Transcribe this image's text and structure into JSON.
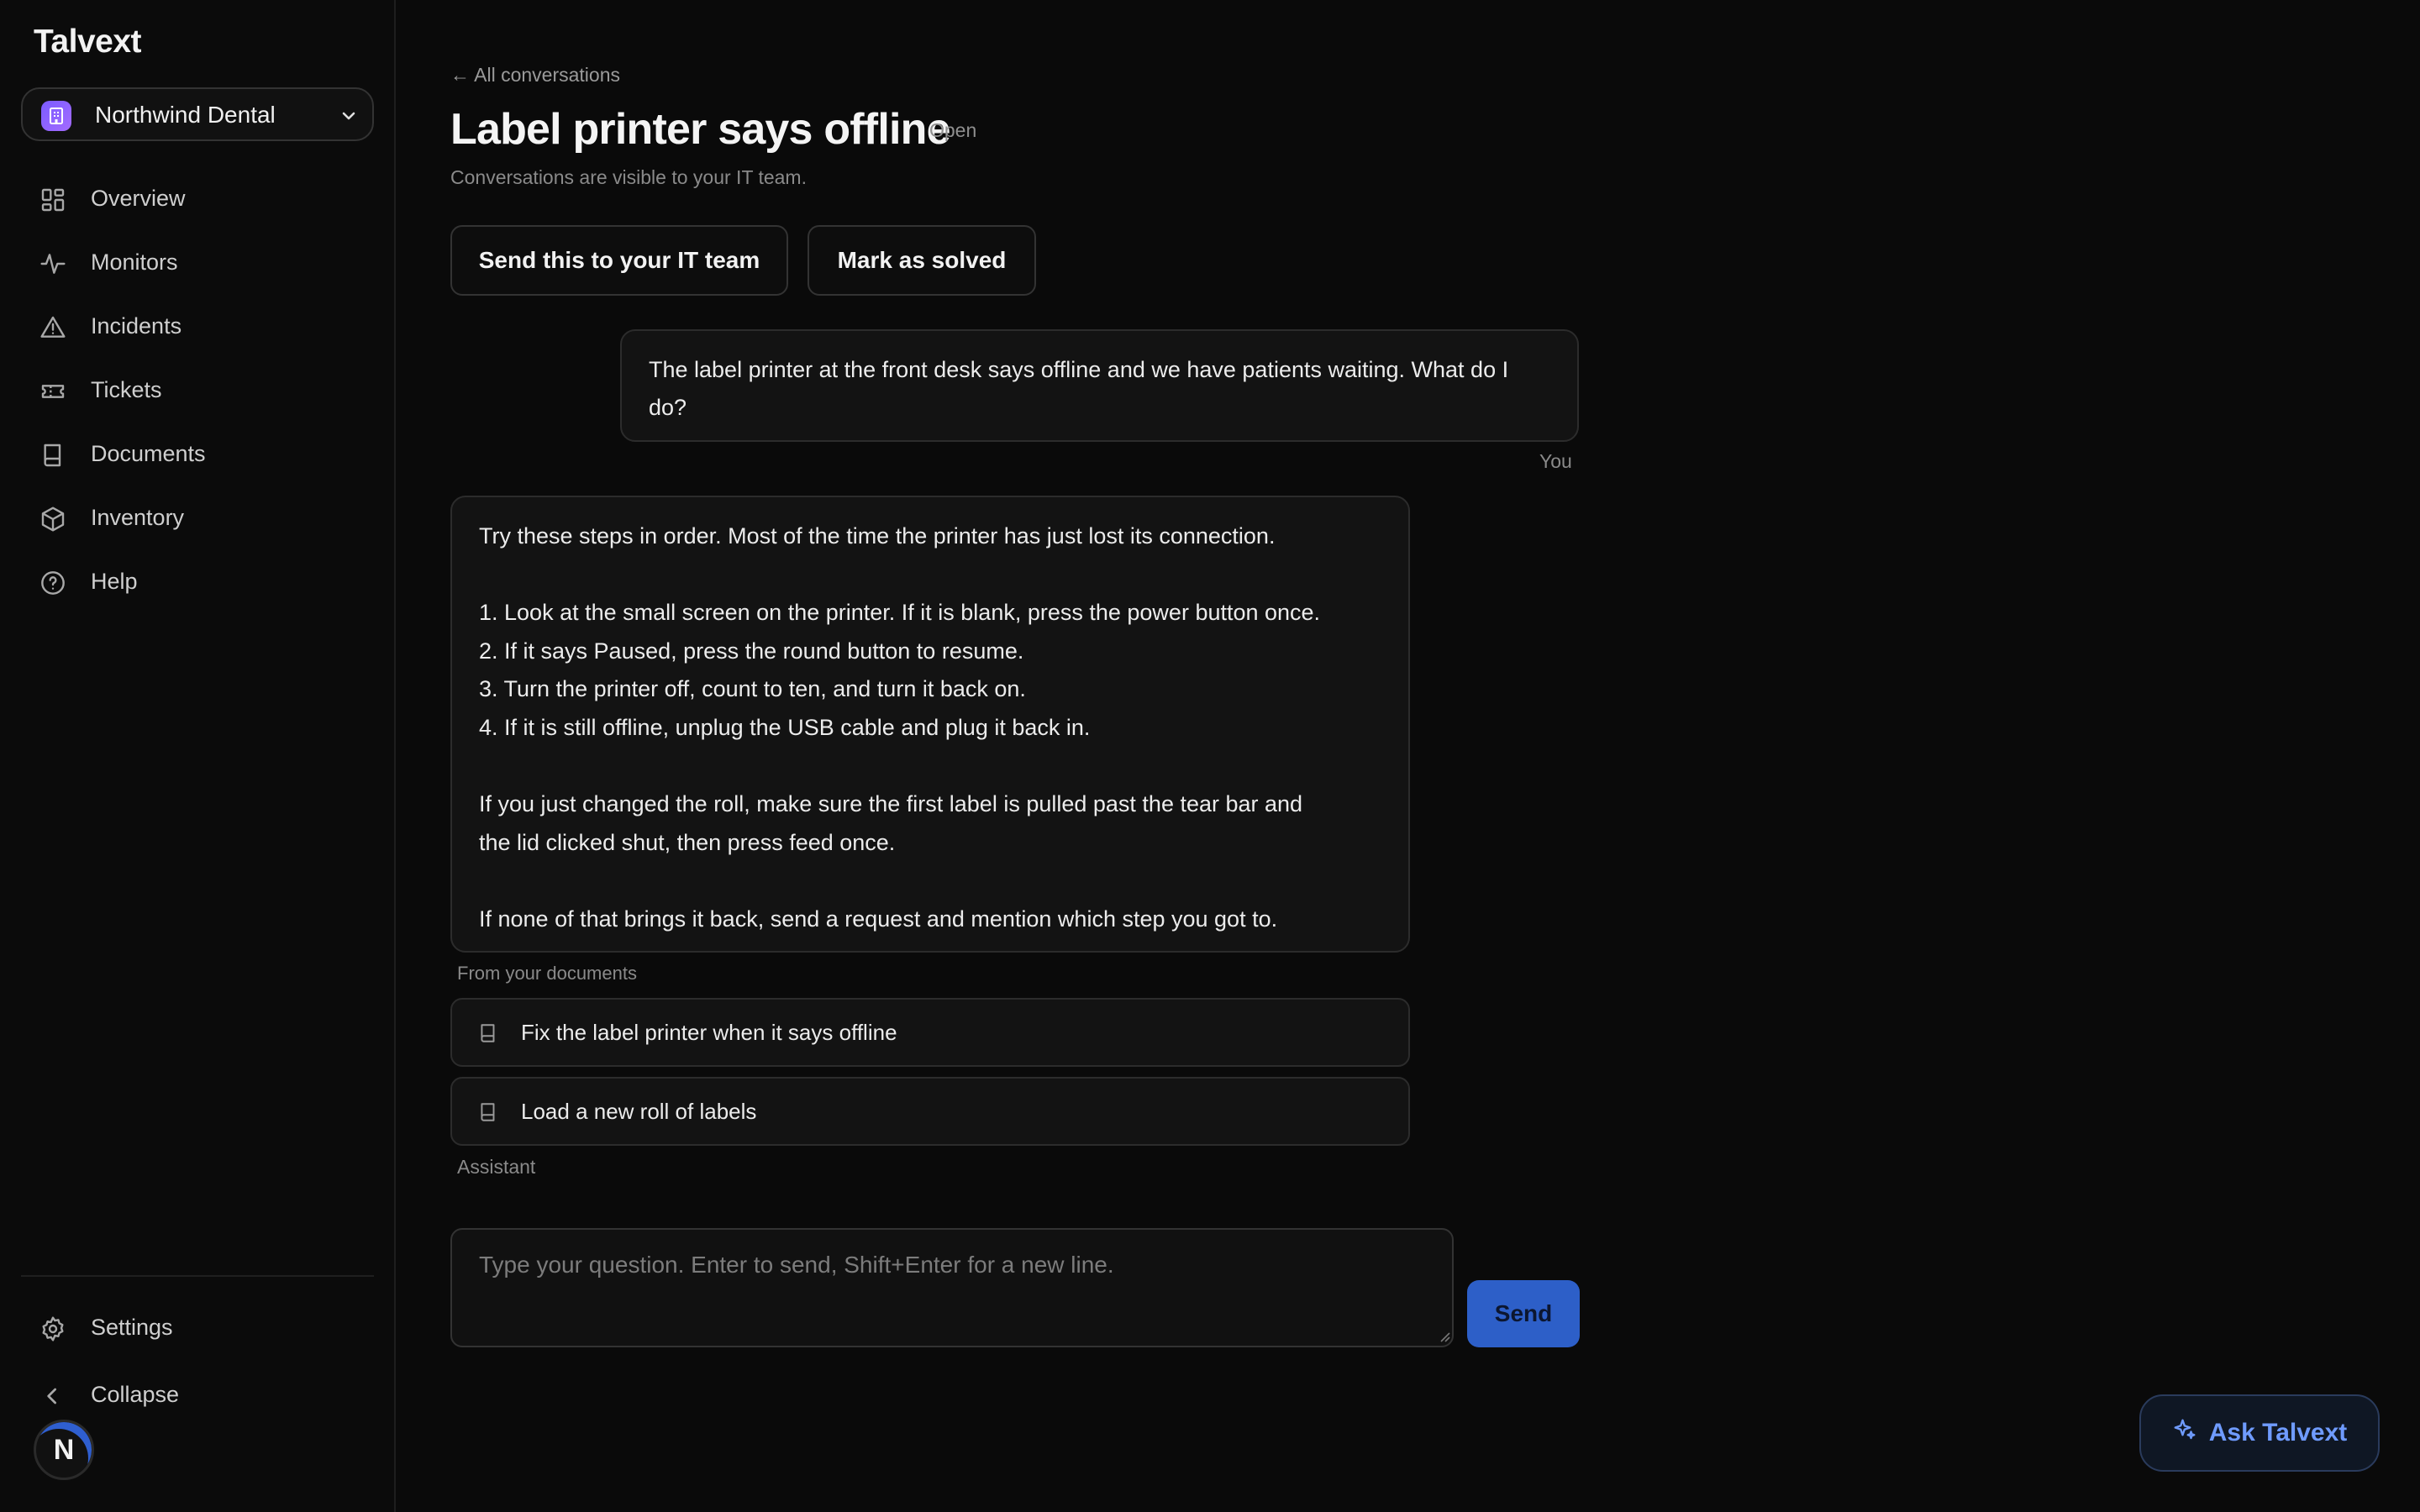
{
  "app": {
    "brand": "Talvext"
  },
  "org": {
    "name": "Northwind Dental"
  },
  "sidebar": {
    "items": [
      {
        "label": "Overview",
        "icon": "grid-icon"
      },
      {
        "label": "Monitors",
        "icon": "pulse-icon"
      },
      {
        "label": "Incidents",
        "icon": "warning-icon"
      },
      {
        "label": "Tickets",
        "icon": "ticket-icon"
      },
      {
        "label": "Documents",
        "icon": "book-icon"
      },
      {
        "label": "Inventory",
        "icon": "box-icon"
      },
      {
        "label": "Help",
        "icon": "help-icon"
      }
    ],
    "settings": "Settings",
    "collapse": "Collapse",
    "avatar_initial": "N"
  },
  "conversation": {
    "back_link": "← All conversations",
    "title": "Label printer says offline",
    "status": "Open",
    "subtitle": "Conversations are visible to your IT team.",
    "send_to_it_label": "Send this to your IT team",
    "mark_solved_label": "Mark as solved",
    "user_message": "The label printer at the front desk says offline and we have patients waiting. What do I do?",
    "user_label": "You",
    "assistant_message": {
      "intro": "Try these steps in order. Most of the time the printer has just lost its connection.",
      "steps": [
        "1. Look at the small screen on the printer. If it is blank, press the power button once.",
        "2. If it says Paused, press the round button to resume.",
        "3. Turn the printer off, count to ten, and turn it back on.",
        "4. If it is still offline, unplug the USB cable and plug it back in."
      ],
      "roll_line1": "If you just changed the roll, make sure the first label is pulled past the tear bar and",
      "roll_line2": "the lid clicked shut, then press feed once.",
      "closing": "If none of that brings it back, send a request and mention which step you got to."
    },
    "sources_label": "From your documents",
    "sources": [
      {
        "title": "Fix the label printer when it says offline"
      },
      {
        "title": "Load a new roll of labels"
      }
    ],
    "assistant_label": "Assistant"
  },
  "composer": {
    "placeholder": "Type your question. Enter to send, Shift+Enter for a new line.",
    "value": "",
    "send_label": "Send"
  },
  "ask_button": {
    "label": "Ask Talvext"
  },
  "colors": {
    "accent": "#2d5fc8",
    "ask_text": "#6f9bff",
    "org_badge": "#7a5cff"
  }
}
